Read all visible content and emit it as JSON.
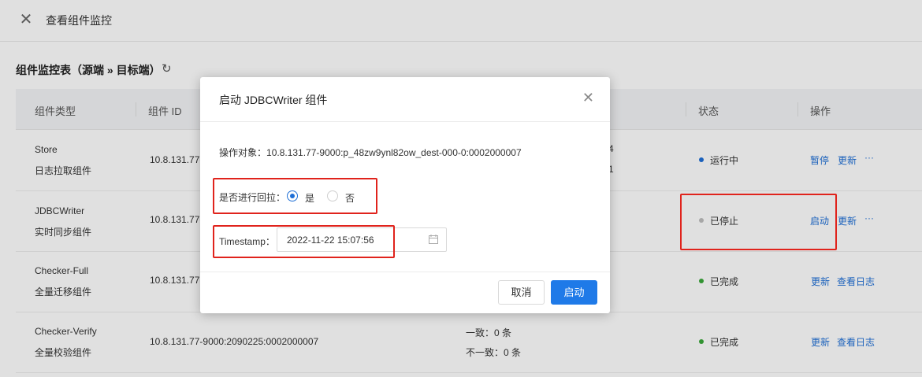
{
  "header": {
    "title": "查看组件监控",
    "close_icon": "close-icon"
  },
  "section": {
    "title": "组件监控表（源端 » 目标端）",
    "refresh_icon": "refresh-icon"
  },
  "table": {
    "columns": {
      "type": "组件类型",
      "id": "组件 ID",
      "status": "状态",
      "ops": "操作"
    },
    "rows": [
      {
        "type_name": "Store",
        "type_desc": "日志拉取组件",
        "id": "10.8.131.77-",
        "extra1": "4",
        "extra2": "1",
        "status": "运行中",
        "status_color": "#1f6fd6",
        "op1": "暂停",
        "op2": "更新",
        "op3": "···"
      },
      {
        "type_name": "JDBCWriter",
        "type_desc": "实时同步组件",
        "id": "10.8.131.77-9",
        "status": "已停止",
        "status_color": "#bfbfbf",
        "op1": "启动",
        "op2": "更新",
        "op3": "···"
      },
      {
        "type_name": "Checker-Full",
        "type_desc": "全量迁移组件",
        "id": "10.8.131.77-9",
        "status": "已完成",
        "status_color": "#3aa83a",
        "op1": "更新",
        "op2": "查看日志"
      },
      {
        "type_name": "Checker-Verify",
        "type_desc": "全量校验组件",
        "id": "10.8.131.77-9000:2090225:0002000007",
        "extra1": "一致：0 条",
        "extra2": "不一致：0 条",
        "status": "已完成",
        "status_color": "#3aa83a",
        "op1": "更新",
        "op2": "查看日志"
      }
    ]
  },
  "dialog": {
    "title": "启动 JDBCWriter 组件",
    "close_icon": "close-icon",
    "target_label": "操作对象：",
    "target_value": "10.8.131.77-9000:p_48zw9ynl82ow_dest-000-0:0002000007",
    "rollback_label": "是否进行回拉：",
    "rollback_options": [
      "是",
      "否"
    ],
    "rollback_selected": "是",
    "timestamp_label": "Timestamp：",
    "timestamp_value": "2022-11-22 15:07:56",
    "calendar_icon": "calendar-icon",
    "cancel_label": "取消",
    "ok_label": "启动"
  },
  "colors": {
    "accent": "#1f7ae8",
    "annotation_red": "#e0231c",
    "running": "#1f6fd6",
    "stopped": "#bfbfbf",
    "done": "#3aa83a"
  }
}
